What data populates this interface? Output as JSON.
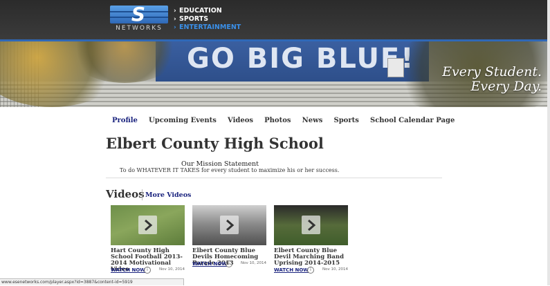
{
  "header": {
    "logo_letter": "S",
    "logo_text": "NETWORKS",
    "nav": [
      {
        "label": "EDUCATION",
        "active": false
      },
      {
        "label": "SPORTS",
        "active": false
      },
      {
        "label": "ENTERTAINMENT",
        "active": true
      }
    ],
    "accent_color": "#2f68b7"
  },
  "hero": {
    "slogan": "GO BIG BLUE!",
    "tagline_line1": "Every Student.",
    "tagline_line2": "Every Day."
  },
  "subnav": [
    "Profile",
    "Upcoming Events",
    "Videos",
    "Photos",
    "News",
    "Sports",
    "School Calendar Page"
  ],
  "school": {
    "title": "Elbert County High School",
    "mission_heading": "Our Mission Statement",
    "mission_text": "To do WHATEVER IT TAKES for every student to maximize his or her success."
  },
  "videos": {
    "heading": "Videos",
    "more_label": "More Videos",
    "items": [
      {
        "title": "Hart County High School Football 2013-2014 Motivational Video",
        "watch": "WATCH NOW",
        "date": "Nov 10, 2014"
      },
      {
        "title": "Elbert County Blue Devils Homecoming Parade 2013",
        "watch": "WATCH NOW",
        "date": "Nov 10, 2014"
      },
      {
        "title": "Elbert County Blue Devil Marching Band Uprising 2014-2015",
        "watch": "WATCH NOW",
        "date": "Nov 10, 2014"
      }
    ]
  },
  "status_bar_url": "www.esenetworks.com/player.aspx?id=3887&content-id=5919"
}
